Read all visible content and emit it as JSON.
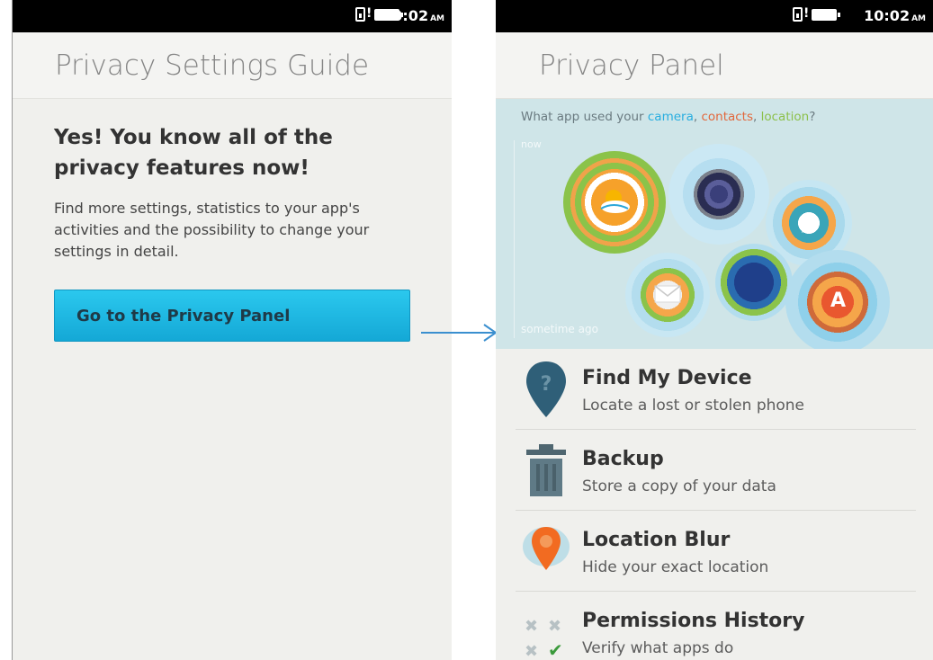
{
  "status_bar": {
    "time": "10:02",
    "ampm": "AM"
  },
  "guide_screen": {
    "header_title": "Privacy Settings Guide",
    "headline": "Yes! You know all of the privacy features now!",
    "description": "Find more settings, statistics to your app's activities and the possibility to change your settings in detail.",
    "button_label": "Go to the Privacy Panel"
  },
  "panel_screen": {
    "header_title": "Privacy Panel",
    "viz": {
      "question_prefix": "What app used your ",
      "camera": "camera",
      "sep1": ", ",
      "contacts": "contacts",
      "sep2": ", ",
      "location": "location",
      "suffix": "?",
      "now_label": "now",
      "ago_label": "sometime ago"
    },
    "items": [
      {
        "title": "Find My Device",
        "subtitle": "Locate a lost or stolen phone",
        "icon": "map-pin-question-icon"
      },
      {
        "title": "Backup",
        "subtitle": "Store a copy of your data",
        "icon": "trash-can-icon"
      },
      {
        "title": "Location Blur",
        "subtitle": "Hide your exact location",
        "icon": "orange-pin-icon"
      },
      {
        "title": "Permissions History",
        "subtitle": "Verify what apps do",
        "icon": "permissions-grid-icon"
      }
    ]
  },
  "colors": {
    "accent_blue": "#14a8d6",
    "camera": "#28aee0",
    "contacts": "#e2673b",
    "location": "#8cc04a",
    "viz_background": "#cfe5e8"
  }
}
